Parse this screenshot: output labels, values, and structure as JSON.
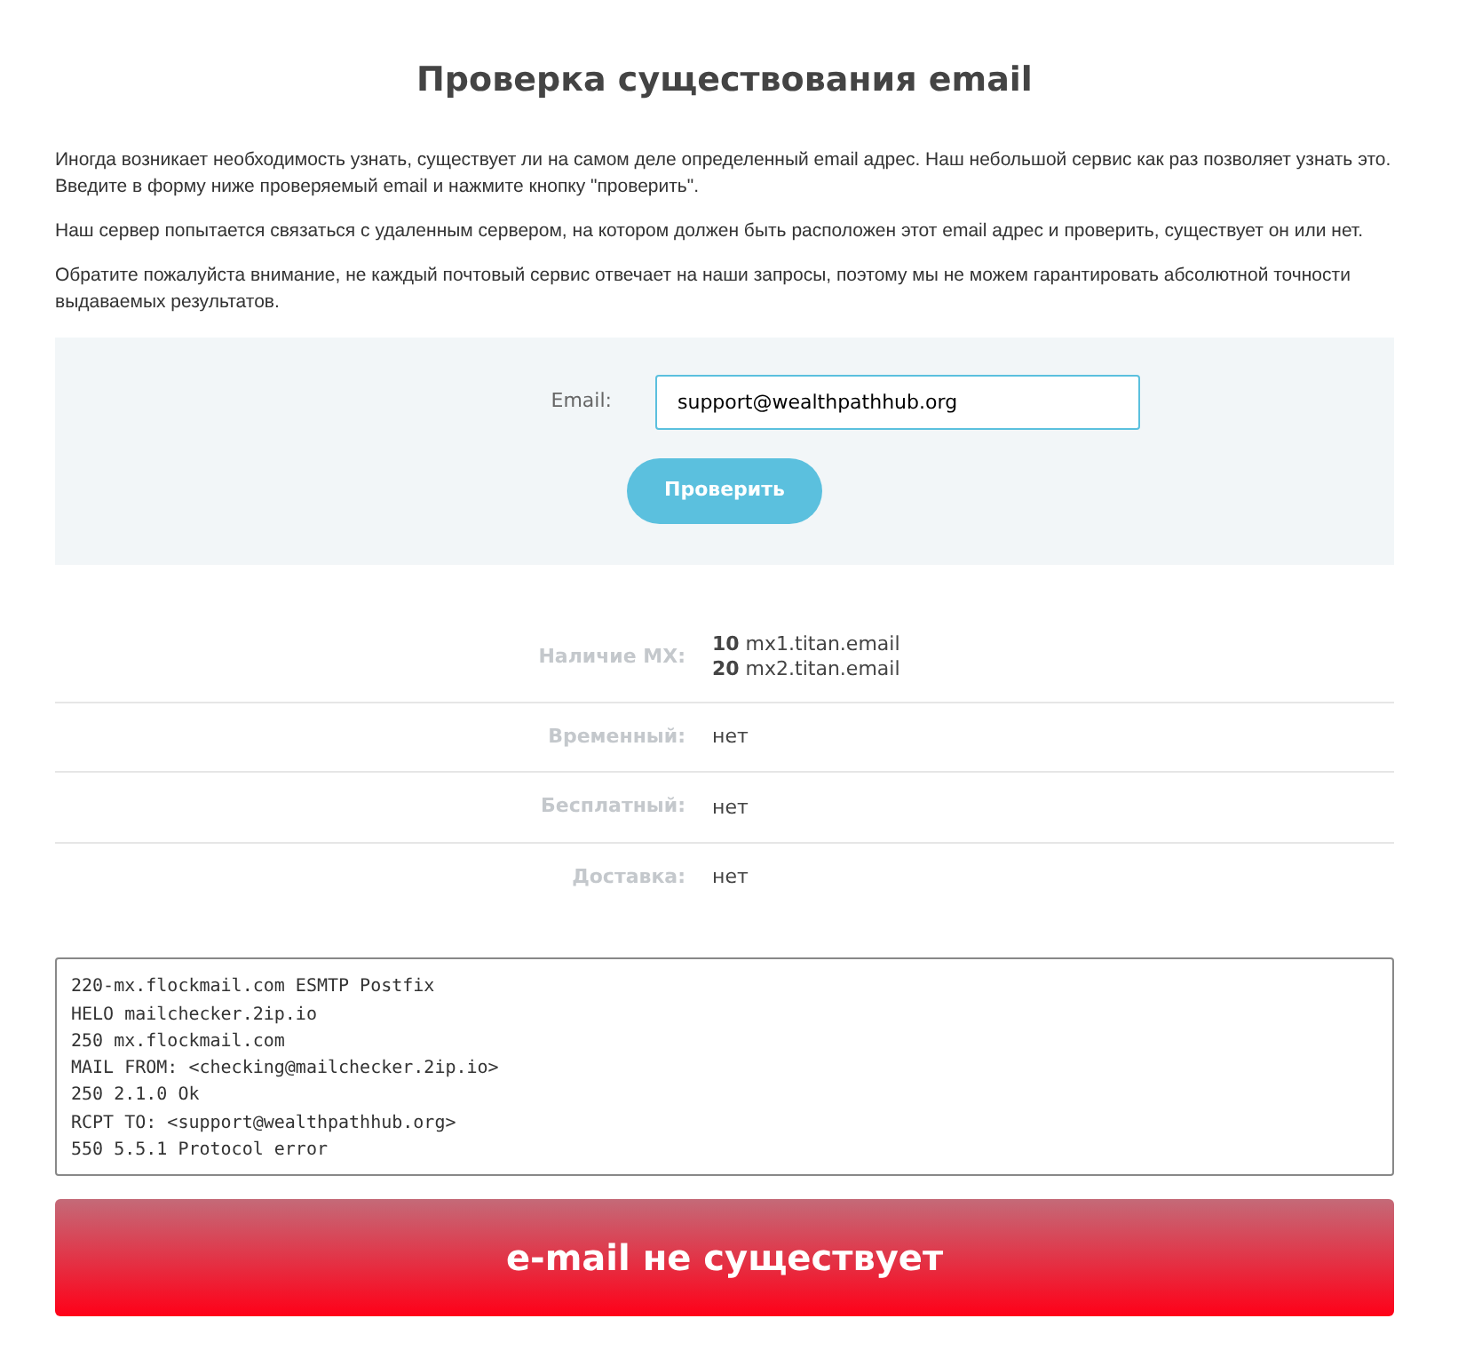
{
  "title": "Проверка существования email",
  "paragraphs": [
    "Иногда возникает необходимость узнать, существует ли на самом деле определенный email адрес. Наш небольшой сервис как раз позволяет узнать это. Введите в форму ниже проверяемый email и нажмите кнопку \"проверить\".",
    "Наш сервер попытается связаться с удаленным сервером, на котором должен быть расположен этот email адрес и проверить, существует он или нет.",
    "Обратите пожалуйста внимание, не каждый почтовый сервис отвечает на наши запросы, поэтому мы не можем гарантировать абсолютной точности выдаваемых результатов."
  ],
  "form": {
    "label": "Email:",
    "value": "support@wealthpathhub.org",
    "button": "Проверить"
  },
  "results": [
    {
      "label": "Наличие MX:",
      "values": [
        "**10** mx1.titan.email",
        "**20** mx2.titan.email"
      ]
    },
    {
      "label": "Временный:",
      "values": [
        "нет"
      ]
    },
    {
      "label": "Бесплатный:",
      "values": [
        "нет"
      ]
    },
    {
      "label": "Доставка:",
      "values": [
        "нет"
      ]
    }
  ],
  "log": [
    "220-mx.flockmail.com ESMTP Postfix",
    "HELO mailchecker.2ip.io",
    "250 mx.flockmail.com",
    "MAIL FROM: <checking@mailchecker.2ip.io>",
    "250 2.1.0 Ok",
    "RCPT TO: <support@wealthpathhub.org>",
    "550 5.5.1 Protocol error"
  ],
  "verdict": {
    "error": true,
    "text": "e-mail не существует"
  }
}
